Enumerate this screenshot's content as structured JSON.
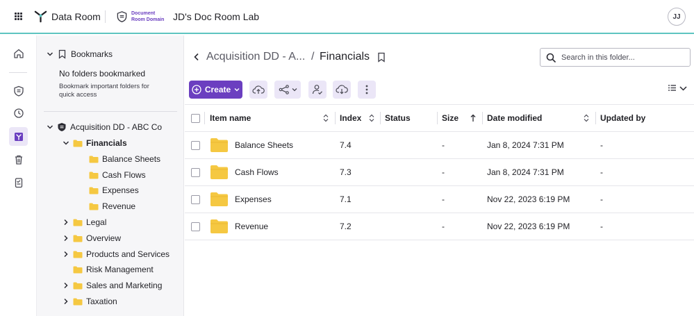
{
  "topbar": {
    "brand_name": "Data Room",
    "domain_line1": "Document",
    "domain_line2": "Room Domain",
    "room_title": "JD's Doc Room Lab",
    "avatar_initials": "JJ",
    "accent_color": "#6b3fc0"
  },
  "rail": {
    "items": [
      "home-icon",
      "data-room-icon",
      "history-icon",
      "tree-icon",
      "trash-icon",
      "checklist-icon"
    ]
  },
  "sidebar": {
    "bookmarks_label": "Bookmarks",
    "bookmarks_empty": "No folders bookmarked",
    "bookmarks_hint": "Bookmark important folders for quick access",
    "root_label": "Acquisition DD - ABC Co",
    "financials_label": "Financials",
    "financials_children": [
      "Balance Sheets",
      "Cash Flows",
      "Expenses",
      "Revenue"
    ],
    "other_folders": [
      "Legal",
      "Overview",
      "Products and Services",
      "Risk Management",
      "Sales and Marketing",
      "Taxation"
    ]
  },
  "breadcrumb": {
    "parent": "Acquisition DD - A...",
    "separator": "/",
    "current": "Financials"
  },
  "search": {
    "placeholder": "Search in this folder..."
  },
  "toolbar": {
    "create_label": "Create"
  },
  "table": {
    "headers": {
      "name": "Item name",
      "index": "Index",
      "status": "Status",
      "size": "Size",
      "date": "Date modified",
      "updated_by": "Updated by"
    },
    "rows": [
      {
        "name": "Balance Sheets",
        "index": "7.4",
        "status": "",
        "size": "-",
        "date": "Jan 8, 2024 7:31 PM",
        "updated_by": "-"
      },
      {
        "name": "Cash Flows",
        "index": "7.3",
        "status": "",
        "size": "-",
        "date": "Jan 8, 2024 7:31 PM",
        "updated_by": "-"
      },
      {
        "name": "Expenses",
        "index": "7.1",
        "status": "",
        "size": "-",
        "date": "Nov 22, 2023 6:19 PM",
        "updated_by": "-"
      },
      {
        "name": "Revenue",
        "index": "7.2",
        "status": "",
        "size": "-",
        "date": "Nov 22, 2023 6:19 PM",
        "updated_by": "-"
      }
    ]
  },
  "colors": {
    "folder": "#f5c842",
    "topbar_border": "#5ec4c0",
    "toolbar_button_bg": "#ebe6f7"
  }
}
